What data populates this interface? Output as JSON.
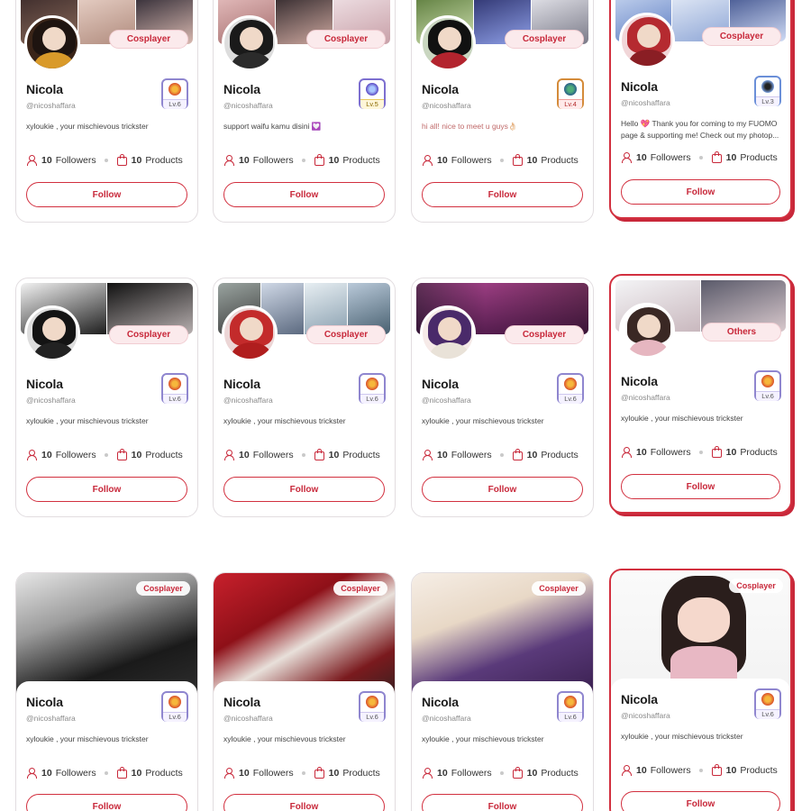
{
  "common": {
    "followers_label": "Followers",
    "products_label": "Products",
    "follow_label": "Follow"
  },
  "colors": {
    "accent": "#c8283a",
    "pill_bg": "#fbeaec",
    "border": "#e2dde0"
  },
  "cards": [
    {
      "name": "Nicola",
      "handle": "@nicoshaffara",
      "bio": "xyloukie , your mischievous trickster",
      "category": "Cosplayer",
      "level": "Lv.6",
      "followers": "10",
      "products": "10"
    },
    {
      "name": "Nicola",
      "handle": "@nicoshaffara",
      "bio": "support waifu kamu disini 💟",
      "category": "Cosplayer",
      "level": "Lv.5",
      "followers": "10",
      "products": "10"
    },
    {
      "name": "Nicola",
      "handle": "@nicoshaffara",
      "bio": "hi all! nice to meet u guys👌🏻",
      "category": "Cosplayer",
      "level": "Lv.4",
      "followers": "10",
      "products": "10"
    },
    {
      "name": "Nicola",
      "handle": "@nicoshaffara",
      "bio": "Hello 💖 Thank you for coming to my FUOMO page & supporting me! Check out my photop...",
      "category": "Cosplayer",
      "level": "Lv.3",
      "followers": "10",
      "products": "10"
    },
    {
      "name": "Nicola",
      "handle": "@nicoshaffara",
      "bio": "xyloukie , your mischievous trickster",
      "category": "Cosplayer",
      "level": "Lv.6",
      "followers": "10",
      "products": "10"
    },
    {
      "name": "Nicola",
      "handle": "@nicoshaffara",
      "bio": "xyloukie , your mischievous trickster",
      "category": "Cosplayer",
      "level": "Lv.6",
      "followers": "10",
      "products": "10"
    },
    {
      "name": "Nicola",
      "handle": "@nicoshaffara",
      "bio": "xyloukie , your mischievous trickster",
      "category": "Cosplayer",
      "level": "Lv.6",
      "followers": "10",
      "products": "10"
    },
    {
      "name": "Nicola",
      "handle": "@nicoshaffara",
      "bio": "xyloukie , your mischievous trickster",
      "category": "Others",
      "level": "Lv.6",
      "followers": "10",
      "products": "10"
    },
    {
      "name": "Nicola",
      "handle": "@nicoshaffara",
      "bio": "xyloukie , your mischievous trickster",
      "category": "Cosplayer",
      "level": "Lv.6",
      "followers": "10",
      "products": "10"
    },
    {
      "name": "Nicola",
      "handle": "@nicoshaffara",
      "bio": "xyloukie , your mischievous trickster",
      "category": "Cosplayer",
      "level": "Lv.6",
      "followers": "10",
      "products": "10"
    },
    {
      "name": "Nicola",
      "handle": "@nicoshaffara",
      "bio": "xyloukie , your mischievous trickster",
      "category": "Cosplayer",
      "level": "Lv.6",
      "followers": "10",
      "products": "10"
    },
    {
      "name": "Nicola",
      "handle": "@nicoshaffara",
      "bio": "xyloukie , your mischievous trickster",
      "category": "Cosplayer",
      "level": "Lv.6",
      "followers": "10",
      "products": "10"
    }
  ]
}
